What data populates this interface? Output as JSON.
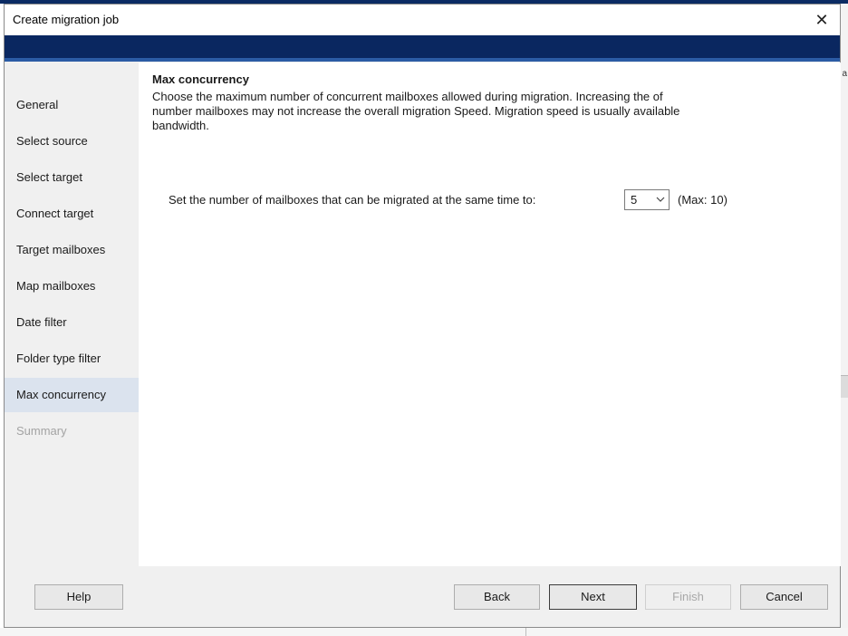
{
  "background": {
    "right_fragment": "a"
  },
  "dialog": {
    "title": "Create migration job",
    "close_glyph": "✕",
    "accent_color": "#0a2760"
  },
  "steps": [
    {
      "label": "General",
      "state": "normal"
    },
    {
      "label": "Select source",
      "state": "normal"
    },
    {
      "label": "Select target",
      "state": "normal"
    },
    {
      "label": "Connect target",
      "state": "normal"
    },
    {
      "label": "Target mailboxes",
      "state": "normal"
    },
    {
      "label": "Map mailboxes",
      "state": "normal"
    },
    {
      "label": "Date filter",
      "state": "normal"
    },
    {
      "label": "Folder type filter",
      "state": "normal"
    },
    {
      "label": "Max concurrency",
      "state": "active"
    },
    {
      "label": "Summary",
      "state": "disabled"
    }
  ],
  "content": {
    "heading": "Max concurrency",
    "description_lines": [
      "Choose the maximum number of concurrent mailboxes allowed during migration. Increasing the of",
      "number mailboxes may not increase the overall migration Speed. Migration speed is usually available",
      "bandwidth."
    ],
    "setting_label": "Set the number of mailboxes that can be migrated at the same time to:",
    "concurrency_value": "5",
    "max_note": "(Max: 10)"
  },
  "buttons": {
    "help": "Help",
    "back": "Back",
    "next": "Next",
    "finish": "Finish",
    "cancel": "Cancel"
  }
}
